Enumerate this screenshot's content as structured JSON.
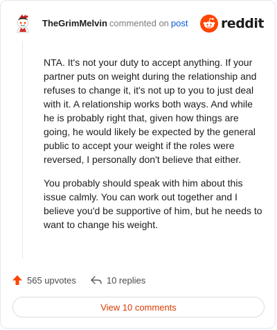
{
  "header": {
    "username": "TheGrimMelvin",
    "commented_text": "commented on",
    "post_link": "post",
    "logo_text": "reddit"
  },
  "comment": {
    "paragraphs": [
      "NTA. It's not your duty to accept anything. If your partner puts on weight during the relationship and refuses to change it, it's not up to you to just deal with it. A relationship works both ways. And while he is probably right that, given how things are going, he would likely be expected by the general public to accept your weight if the roles were reversed, I personally don't believe that either.",
      "You probably should speak with him about this issue calmly. You can work out together and I believe you'd be supportive of him, but he needs to want to change his weight."
    ]
  },
  "actions": {
    "upvotes": "565 upvotes",
    "replies": "10 replies"
  },
  "footer": {
    "view_comments": "View 10 comments"
  },
  "colors": {
    "brand": "#ff4500",
    "link": "#0a5ad6",
    "button_text": "#d93a00",
    "muted": "#7c7c7c"
  },
  "icons": {
    "avatar": "snoo-avatar-icon",
    "logo": "reddit-logo-icon",
    "upvote": "upvote-arrow-icon",
    "reply": "reply-arrow-icon"
  }
}
